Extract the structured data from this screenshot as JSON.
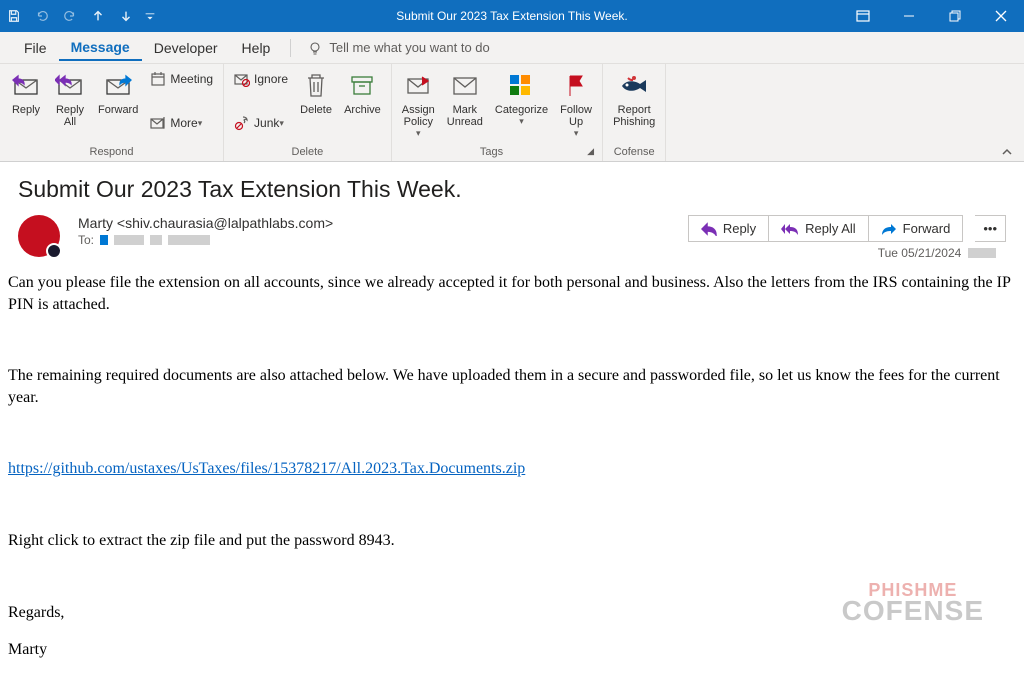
{
  "titlebar": {
    "title": "Submit Our 2023 Tax Extension This Week."
  },
  "menu": {
    "file": "File",
    "message": "Message",
    "developer": "Developer",
    "help": "Help",
    "tell_me": "Tell me what you want to do"
  },
  "ribbon": {
    "respond": {
      "label": "Respond",
      "reply": "Reply",
      "reply_all": "Reply\nAll",
      "forward": "Forward",
      "meeting": "Meeting",
      "more": "More"
    },
    "delete": {
      "label": "Delete",
      "ignore": "Ignore",
      "junk": "Junk",
      "delete": "Delete",
      "archive": "Archive"
    },
    "tags": {
      "label": "Tags",
      "assign_policy": "Assign\nPolicy",
      "mark_unread": "Mark\nUnread",
      "categorize": "Categorize",
      "follow_up": "Follow\nUp"
    },
    "cofense": {
      "label": "Cofense",
      "report": "Report\nPhishing"
    }
  },
  "message": {
    "subject": "Submit Our 2023 Tax Extension This Week.",
    "sender": "Marty <shiv.chaurasia@lalpathlabs.com>",
    "to_label": "To:",
    "date": "Tue 05/21/2024",
    "actions": {
      "reply": "Reply",
      "reply_all": "Reply All",
      "forward": "Forward"
    },
    "body": {
      "p1": "Can you please file the extension on all accounts, since we already accepted it for both personal and business. Also the letters from the IRS containing the IP PIN is attached.",
      "p2": "The remaining required documents are also attached below. We have uploaded them in a secure and passworded file, so let us know the fees for the current year.",
      "link": "https://github.com/ustaxes/UsTaxes/files/15378217/All.2023.Tax.Documents.zip",
      "p3": "Right click to extract the zip file and put the password 8943.",
      "p4": "Regards,",
      "p5": "Marty"
    }
  },
  "watermark": {
    "line1": "PHISHME",
    "line2": "COFENSE"
  }
}
